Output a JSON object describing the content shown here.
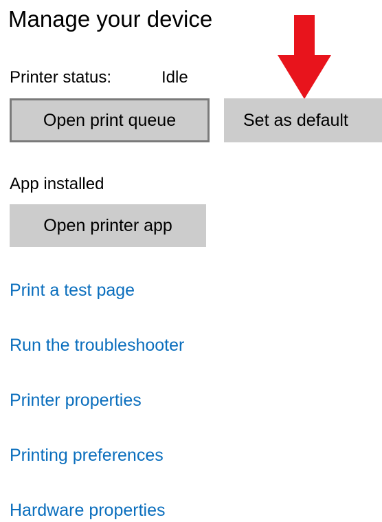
{
  "section": {
    "title": "Manage your device"
  },
  "status": {
    "label": "Printer status:",
    "value": "Idle"
  },
  "buttons": {
    "open_print_queue": "Open print queue",
    "set_as_default": "Set as default",
    "open_printer_app": "Open printer app"
  },
  "app": {
    "label": "App installed"
  },
  "links": [
    "Print a test page",
    "Run the troubleshooter",
    "Printer properties",
    "Printing preferences",
    "Hardware properties"
  ],
  "colors": {
    "link": "#0a6ebd",
    "button_bg": "#cccccc",
    "arrow": "#e8141c"
  },
  "annotation": {
    "icon": "red-down-arrow-icon"
  }
}
